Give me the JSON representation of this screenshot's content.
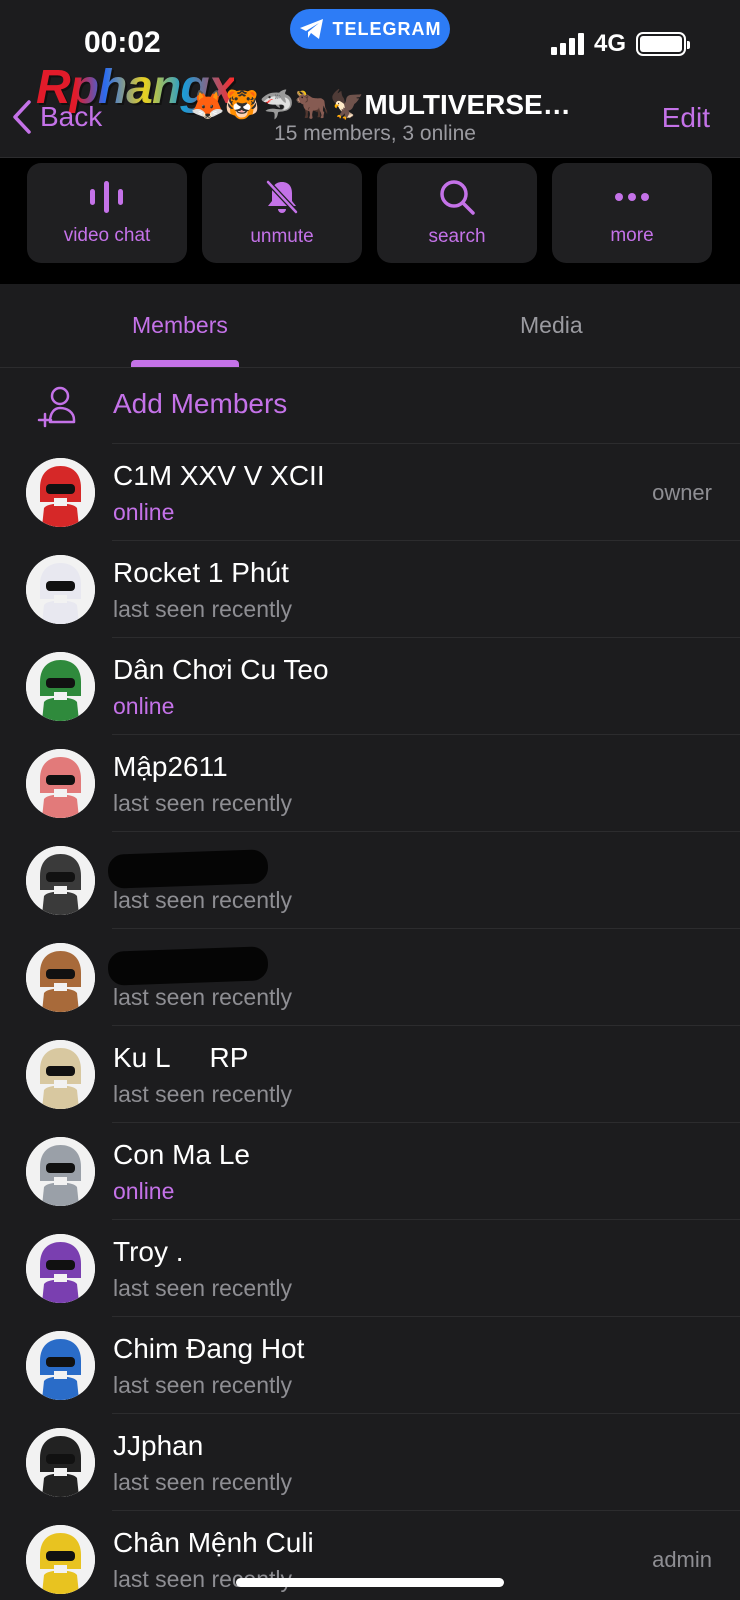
{
  "status_bar": {
    "time": "00:02",
    "app_pill": "TELEGRAM",
    "network": "4G"
  },
  "watermark": "Rphangx",
  "header": {
    "back_label": "Back",
    "title": "🦊🐯🦈🐂🦅MULTIVERSE…",
    "subtitle": "15 members, 3 online",
    "edit_label": "Edit"
  },
  "actions": [
    {
      "label": "video chat",
      "icon": "video-chat-icon"
    },
    {
      "label": "unmute",
      "icon": "bell-slash-icon"
    },
    {
      "label": "search",
      "icon": "search-icon"
    },
    {
      "label": "more",
      "icon": "more-dots-icon"
    }
  ],
  "tabs": [
    {
      "label": "Members",
      "active": true
    },
    {
      "label": "Media",
      "active": false
    }
  ],
  "add_members_label": "Add Members",
  "members": [
    {
      "name": "C1M XXV V XCII",
      "status": "online",
      "role": "owner",
      "avatar_color": "#d62828"
    },
    {
      "name": "Rocket 1 Phút",
      "status": "last seen recently",
      "role": "",
      "avatar_color": "#e8e8f0"
    },
    {
      "name": "Dân Chơi Cu Teo",
      "status": "online",
      "role": "",
      "avatar_color": "#2f8a3c"
    },
    {
      "name": "Mập2611",
      "status": "last seen recently",
      "role": "",
      "avatar_color": "#e27a7a"
    },
    {
      "name": "",
      "status": "last seen recently",
      "role": "",
      "avatar_color": "#3a3a3a",
      "redacted": true
    },
    {
      "name": "",
      "status": "last seen recently",
      "role": "",
      "avatar_color": "#a86a3a",
      "redacted": true
    },
    {
      "name": "Ku L     RP",
      "status": "last seen recently",
      "role": "",
      "avatar_color": "#d8c8a0"
    },
    {
      "name": "Con Ma Le",
      "status": "online",
      "role": "",
      "avatar_color": "#9aa0a8"
    },
    {
      "name": "Troy .",
      "status": "last seen recently",
      "role": "",
      "avatar_color": "#7a3fb0"
    },
    {
      "name": "Chim Đang Hot",
      "status": "last seen recently",
      "role": "",
      "avatar_color": "#2a6cc8"
    },
    {
      "name": "JJphan",
      "status": "last seen recently",
      "role": "",
      "avatar_color": "#222222"
    },
    {
      "name": "Chân Mệnh Culi",
      "status": "last seen recently",
      "role": "admin",
      "avatar_color": "#e8c320"
    }
  ],
  "colors": {
    "accent": "#c472e8",
    "background": "#1c1c1e",
    "telegram_blue": "#2d7cf6"
  }
}
